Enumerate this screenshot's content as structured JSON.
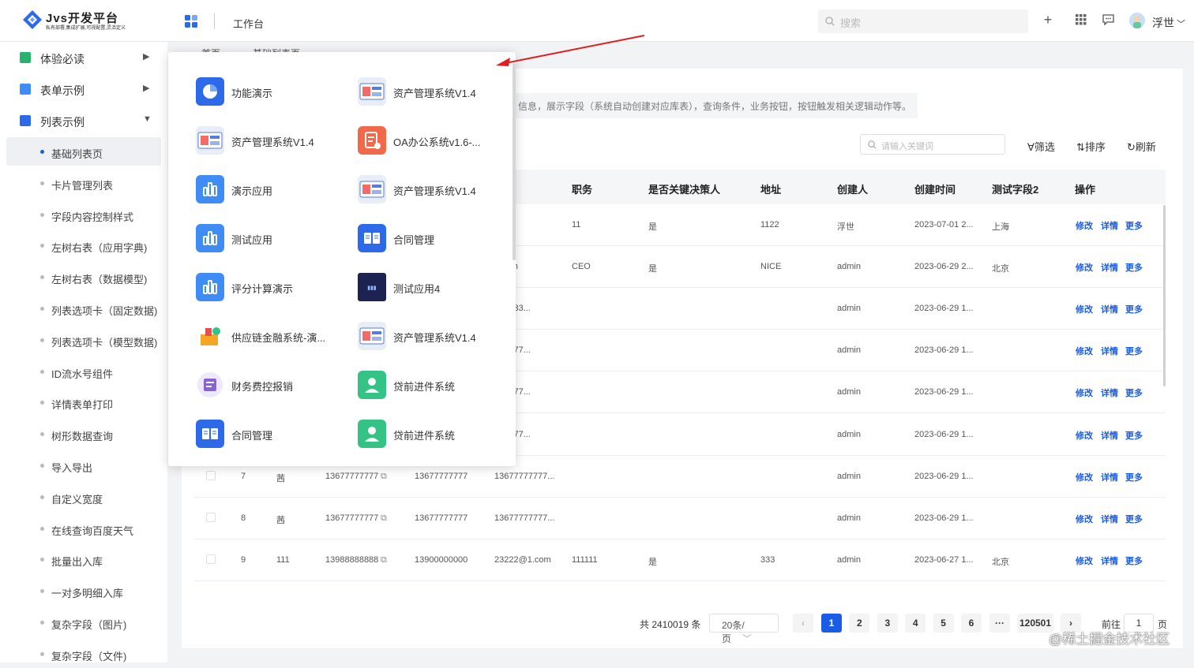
{
  "topbar": {
    "logo_title": "Jvs开发平台",
    "logo_subtitle": "私有部署,集成扩展,可视配置,灵活定义",
    "page_title": "工作台",
    "search_placeholder": "搜索",
    "username": "浮世"
  },
  "sidebar": {
    "groups": [
      {
        "label": "体验必读",
        "color": "#27b36f"
      },
      {
        "label": "表单示例",
        "color": "#3f8cf5"
      },
      {
        "label": "列表示例",
        "color": "#2d6ae9"
      }
    ],
    "items": [
      "基础列表页",
      "卡片管理列表",
      "字段内容控制样式",
      "左树右表（应用字典)",
      "左树右表（数据模型)",
      "列表选项卡（固定数据)",
      "列表选项卡（模型数据)",
      "ID流水号组件",
      "详情表单打印",
      "树形数据查询",
      "导入导出",
      "自定义宽度",
      "在线查询百度天气",
      "批量出入库",
      "一对多明细入库",
      "复杂字段（图片)",
      "复杂字段（文件)"
    ]
  },
  "breadcrumb": {
    "home": "首页",
    "current": "基础列表页"
  },
  "description": "信息，展示字段（系统自动创建对应库表），查询条件，业务按钮，按钮触发相关逻辑动作等。",
  "toolbar": {
    "keyword_placeholder": "请输入关键词",
    "filter": "筛选",
    "sort": "排序",
    "refresh": "刷新"
  },
  "table": {
    "headers": [
      "职务",
      "是否关键决策人",
      "地址",
      "创建人",
      "创建时间",
      "测试字段2",
      "操作"
    ],
    "actions": [
      "修改",
      "详情",
      "更多"
    ],
    "rows": [
      {
        "email": "om",
        "title": "11",
        "key": "是",
        "addr": "1122",
        "creator": "浮世",
        "time": "2023-07-01 2...",
        "f2": "上海"
      },
      {
        "email": "9.com",
        "title": "CEO",
        "key": "是",
        "addr": "NICE",
        "creator": "admin",
        "time": "2023-06-29 2...",
        "f2": "北京"
      },
      {
        "email": "333333...",
        "title": "",
        "key": "",
        "addr": "",
        "creator": "admin",
        "time": "2023-06-29 1...",
        "f2": ""
      },
      {
        "email": "777777...",
        "title": "",
        "key": "",
        "addr": "",
        "creator": "admin",
        "time": "2023-06-29 1...",
        "f2": ""
      },
      {
        "email": "777777...",
        "title": "",
        "key": "",
        "addr": "",
        "creator": "admin",
        "time": "2023-06-29 1...",
        "f2": ""
      },
      {
        "email": "777777...",
        "title": "",
        "key": "",
        "addr": "",
        "creator": "admin",
        "time": "2023-06-29 1...",
        "f2": ""
      },
      {
        "no": "7",
        "name": "茜",
        "phone": "13677777777",
        "phone2": "13677777777",
        "email": "13677777777...",
        "title": "",
        "key": "",
        "addr": "",
        "creator": "admin",
        "time": "2023-06-29 1...",
        "f2": ""
      },
      {
        "no": "8",
        "name": "茜",
        "phone": "13677777777",
        "phone2": "13677777777",
        "email": "13677777777...",
        "title": "",
        "key": "",
        "addr": "",
        "creator": "admin",
        "time": "2023-06-29 1...",
        "f2": ""
      },
      {
        "no": "9",
        "name": "111",
        "phone": "13988888888",
        "phone2": "13900000000",
        "email": "23222@1.com",
        "title": "111111",
        "key": "是",
        "addr": "333",
        "creator": "admin",
        "time": "2023-06-27 1...",
        "f2": "北京"
      }
    ]
  },
  "pagination": {
    "total": "共 2410019 条",
    "page_size": "20条/页",
    "pages": [
      "1",
      "2",
      "3",
      "4",
      "5",
      "6"
    ],
    "ellipsis": "···",
    "last": "120501",
    "goto_label": "前往",
    "goto_value": "1",
    "page_unit": "页"
  },
  "apps": [
    {
      "name": "功能演示",
      "icon": "pie-chart-icon",
      "color": "#2d6ae9"
    },
    {
      "name": "资产管理系统V1.4",
      "icon": "asset-illustration-icon",
      "color": "#e8eef8"
    },
    {
      "name": "资产管理系统V1.4",
      "icon": "asset-illustration-icon",
      "color": "#e8eef8"
    },
    {
      "name": "OA办公系统v1.6-...",
      "icon": "document-icon",
      "color": "#f2694a"
    },
    {
      "name": "演示应用",
      "icon": "bar-chart-icon",
      "color": "#3f8cf5"
    },
    {
      "name": "资产管理系统V1.4",
      "icon": "asset-illustration-icon",
      "color": "#e8eef8"
    },
    {
      "name": "测试应用",
      "icon": "bar-chart-icon",
      "color": "#3f8cf5"
    },
    {
      "name": "合同管理",
      "icon": "book-icon",
      "color": "#2d6ae9"
    },
    {
      "name": "评分计算演示",
      "icon": "bar-chart-icon",
      "color": "#3f8cf5"
    },
    {
      "name": "测试应用4",
      "icon": "dark-banner-icon",
      "color": "#1c2350"
    },
    {
      "name": "供应链金融系统-演...",
      "icon": "supply-illustration-icon",
      "color": "#ffffff"
    },
    {
      "name": "资产管理系统V1.4",
      "icon": "asset-illustration-icon",
      "color": "#e8eef8"
    },
    {
      "name": "财务费控报销",
      "icon": "finance-illustration-icon",
      "color": "#ffffff"
    },
    {
      "name": "贷前进件系统",
      "icon": "user-icon",
      "color": "#34c285"
    },
    {
      "name": "合同管理",
      "icon": "book-icon",
      "color": "#2d6ae9"
    },
    {
      "name": "贷前进件系统",
      "icon": "user-icon",
      "color": "#34c285"
    }
  ],
  "watermark": "@稀土掘金技术社区",
  "colors": {
    "primary": "#1a5ce6",
    "arrow": "#e02020"
  }
}
